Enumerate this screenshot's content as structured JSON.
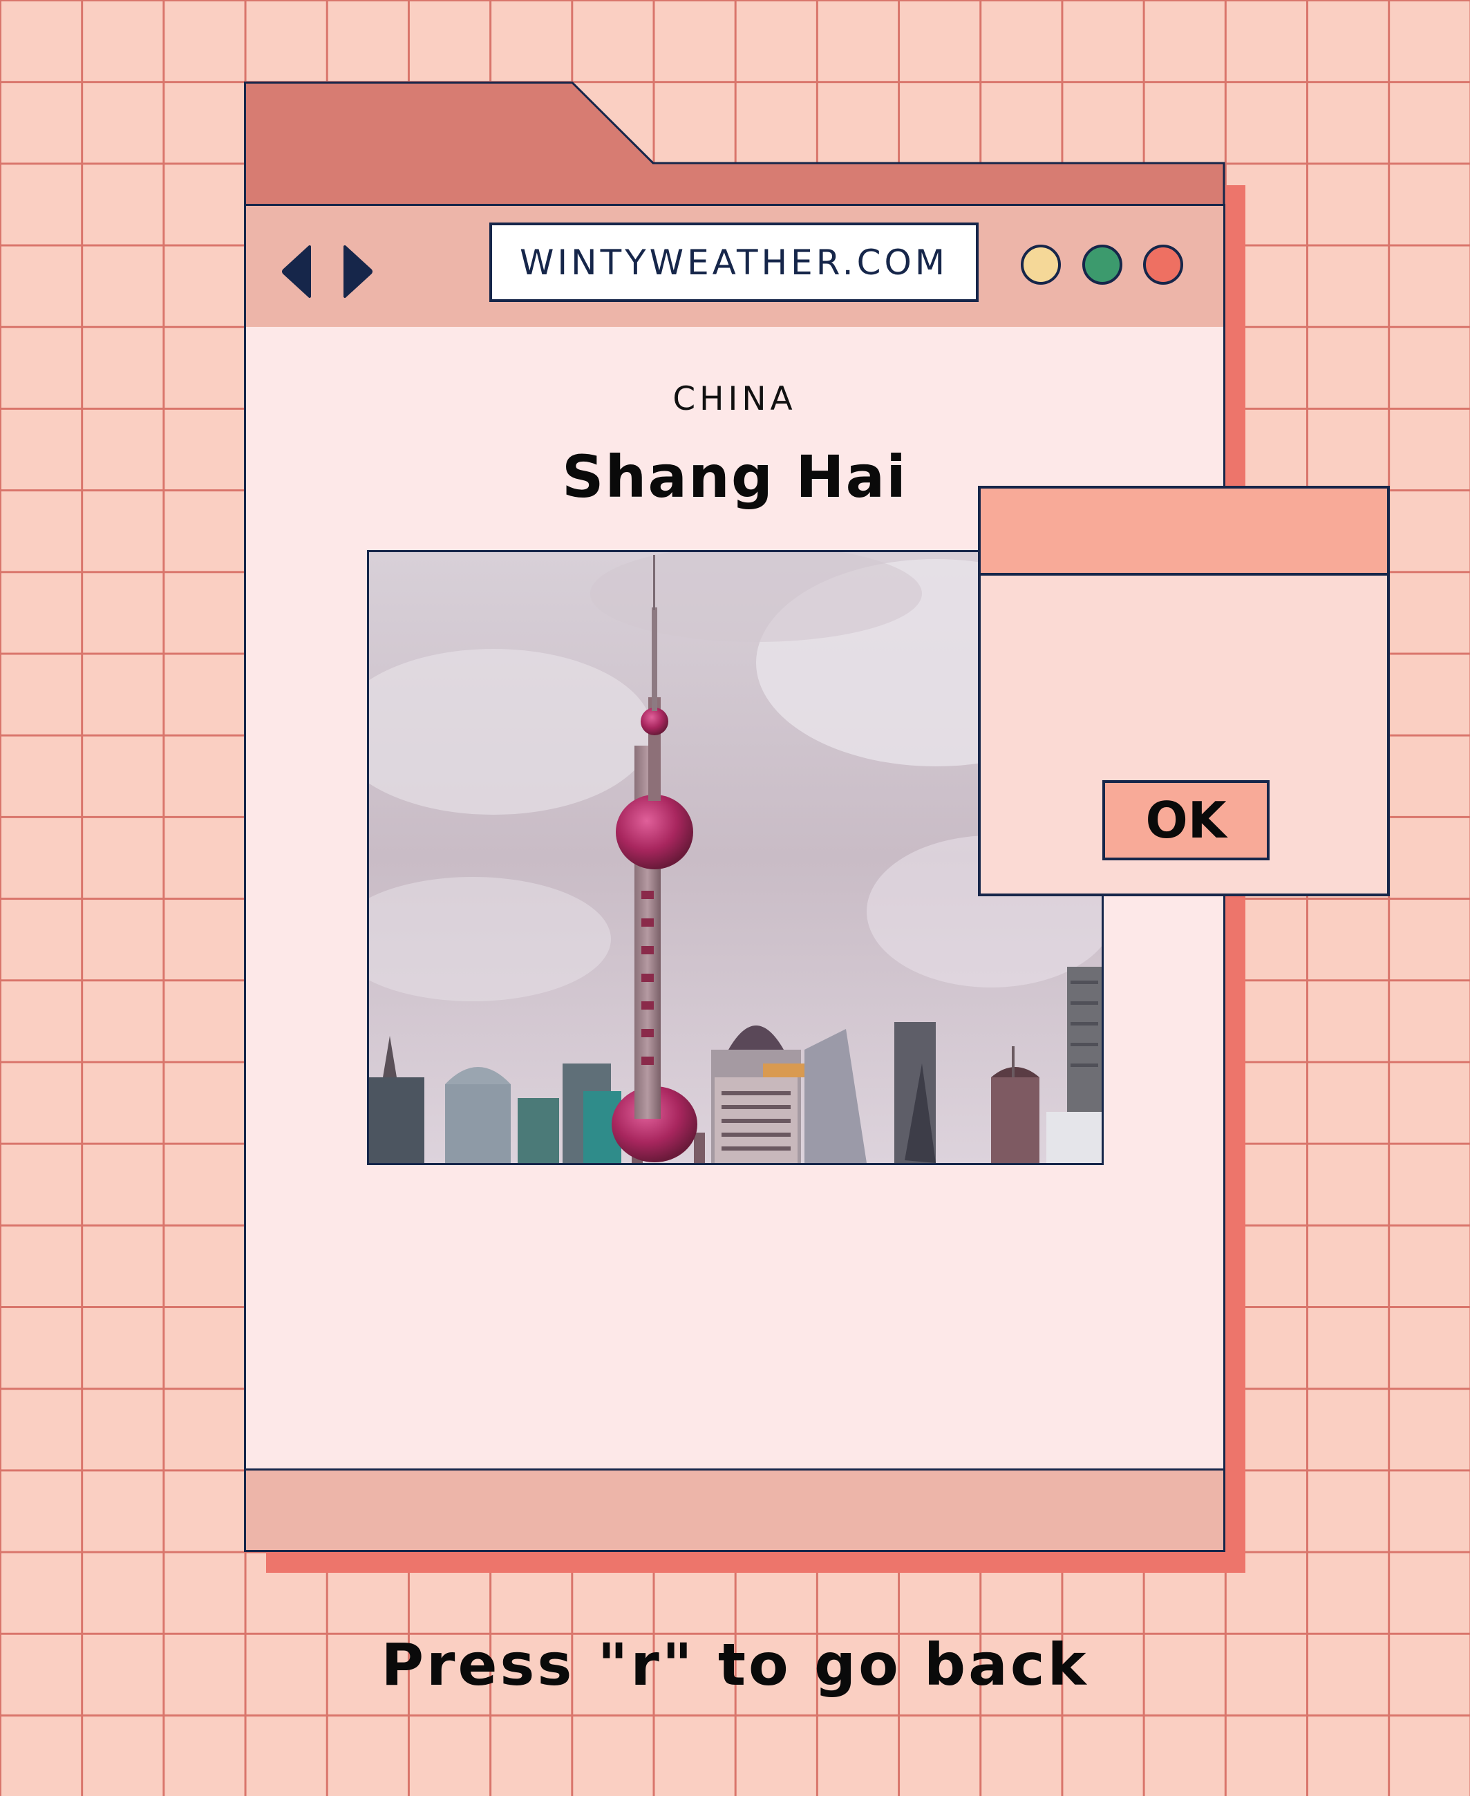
{
  "browser": {
    "url": "WINTYWEATHER.COM"
  },
  "page": {
    "country": "CHINA",
    "city": "Shang Hai"
  },
  "dialog": {
    "ok_label": "OK"
  },
  "hint": "Press \"r\" to go back",
  "icons": {
    "back": "back-arrow-icon",
    "forward": "forward-arrow-icon",
    "window_controls": [
      "yellow-dot",
      "green-dot",
      "red-dot"
    ]
  },
  "colors": {
    "background": "#facfc2",
    "grid_line": "#d9756b",
    "tab": "#d77c72",
    "toolbar": "#edb5a9",
    "content": "#fde8e8",
    "shadow": "#ed756b",
    "outline": "#16264a",
    "dialog_title": "#f8aa98",
    "dialog_body": "#fbdad4",
    "dot_yellow": "#f5d898",
    "dot_green": "#3c9a6d",
    "dot_red": "#ee7062"
  }
}
